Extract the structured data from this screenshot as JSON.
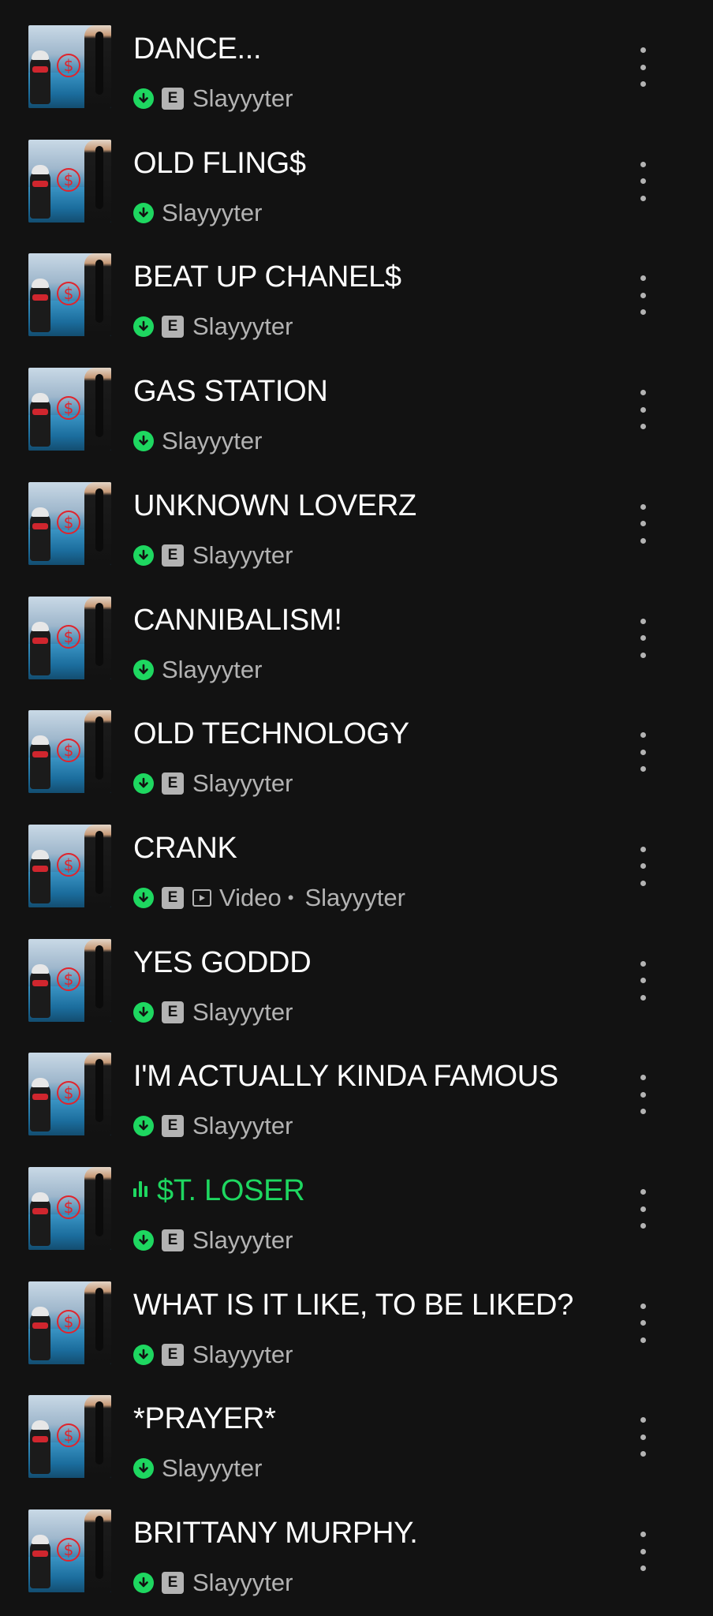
{
  "colors": {
    "background": "#121212",
    "accent": "#1ed760",
    "secondary_text": "#b3b3b3",
    "primary_text": "#ffffff"
  },
  "tracks": [
    {
      "title": "DANCE...",
      "artist": "Slayyyter",
      "explicit": true,
      "downloaded": true
    },
    {
      "title": "OLD FLING$",
      "artist": "Slayyyter",
      "explicit": false,
      "downloaded": true
    },
    {
      "title": "BEAT UP CHANEL$",
      "artist": "Slayyyter",
      "explicit": true,
      "downloaded": true
    },
    {
      "title": "GAS STATION",
      "artist": "Slayyyter",
      "explicit": false,
      "downloaded": true
    },
    {
      "title": "UNKNOWN LOVERZ",
      "artist": "Slayyyter",
      "explicit": true,
      "downloaded": true
    },
    {
      "title": "CANNIBALISM!",
      "artist": "Slayyyter",
      "explicit": false,
      "downloaded": true
    },
    {
      "title": "OLD TECHNOLOGY",
      "artist": "Slayyyter",
      "explicit": true,
      "downloaded": true
    },
    {
      "title": "CRANK",
      "artist": "Slayyyter",
      "explicit": true,
      "downloaded": true,
      "video_label": "Video",
      "separator": "•"
    },
    {
      "title": "YES GODDD",
      "artist": "Slayyyter",
      "explicit": true,
      "downloaded": true
    },
    {
      "title": "I'M ACTUALLY KINDA FAMOUS",
      "artist": "Slayyyter",
      "explicit": true,
      "downloaded": true
    },
    {
      "title": "$T. LOSER",
      "artist": "Slayyyter",
      "explicit": true,
      "downloaded": true,
      "playing": true
    },
    {
      "title": "WHAT IS IT LIKE, TO BE LIKED?",
      "artist": "Slayyyter",
      "explicit": true,
      "downloaded": true
    },
    {
      "title": "*PRAYER*",
      "artist": "Slayyyter",
      "explicit": false,
      "downloaded": true
    },
    {
      "title": "BRITTANY MURPHY.",
      "artist": "Slayyyter",
      "explicit": true,
      "downloaded": true
    }
  ],
  "explicit_badge": "E",
  "icons": {
    "download": "download-check-icon",
    "explicit": "explicit-badge",
    "video": "video-icon",
    "more": "more-options-icon",
    "playing": "equalizer-icon",
    "cover": "album-cover"
  }
}
